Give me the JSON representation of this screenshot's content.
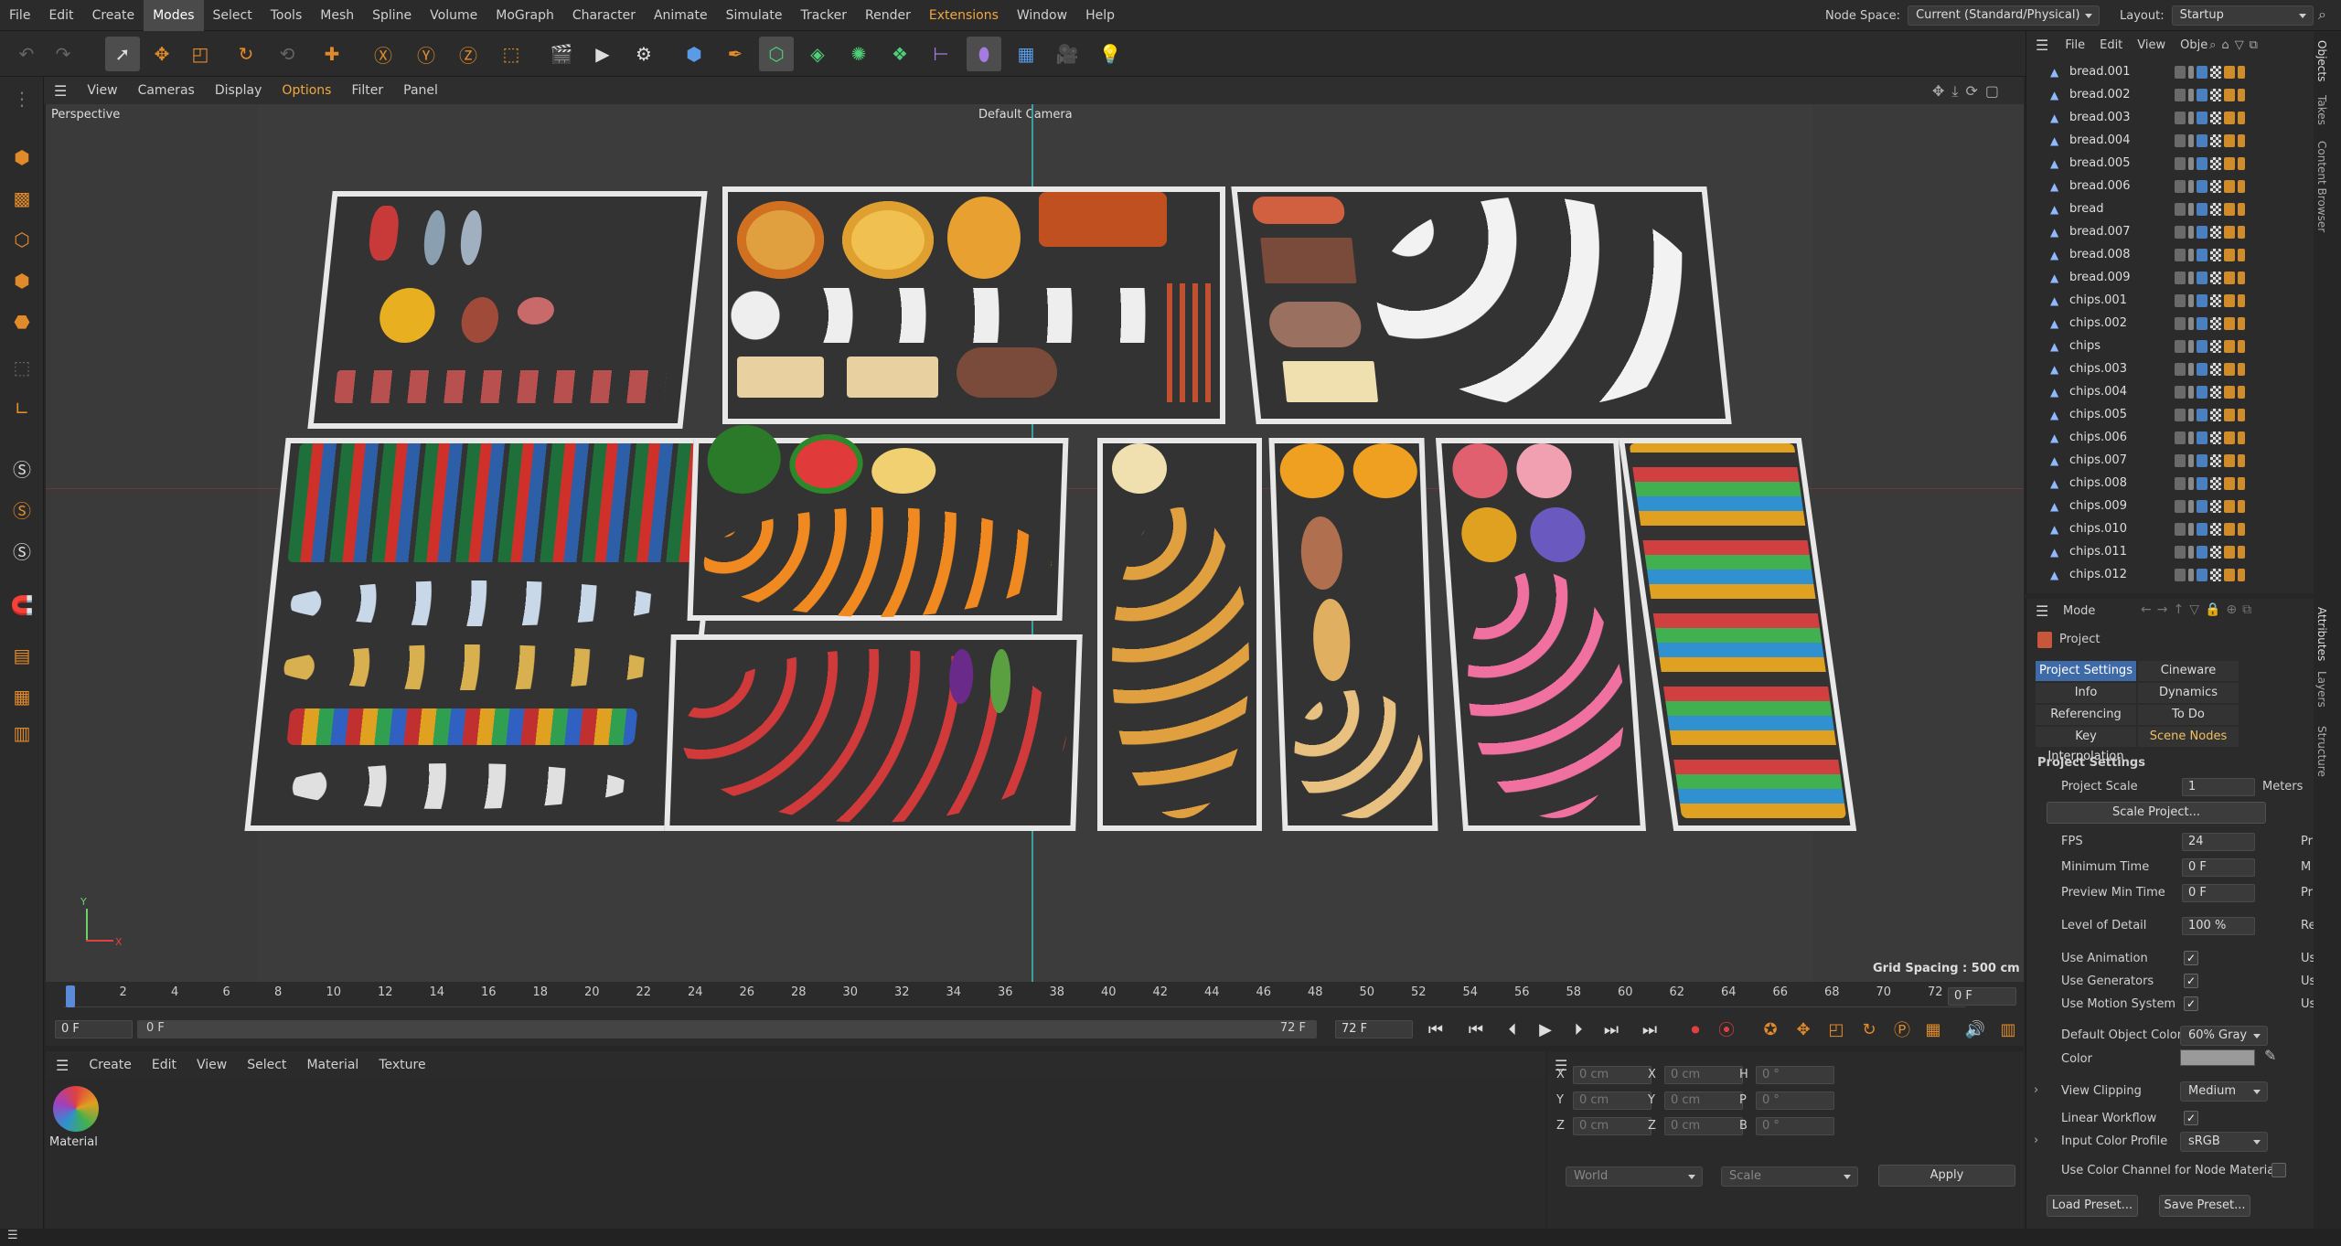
{
  "menubar": {
    "items": [
      "File",
      "Edit",
      "Create",
      "Modes",
      "Select",
      "Tools",
      "Mesh",
      "Spline",
      "Volume",
      "MoGraph",
      "Character",
      "Animate",
      "Simulate",
      "Tracker",
      "Render",
      "Extensions",
      "Window",
      "Help"
    ],
    "node_space_label": "Node Space:",
    "node_space_value": "Current (Standard/Physical)",
    "layout_label": "Layout:",
    "layout_value": "Startup"
  },
  "viewport_menu": [
    "View",
    "Cameras",
    "Display",
    "Options",
    "Filter",
    "Panel"
  ],
  "viewport": {
    "view_name": "Perspective",
    "camera": "Default Camera",
    "grid_spacing": "Grid Spacing : 500 cm",
    "axis_y": "Y",
    "axis_x": "X"
  },
  "timeline": {
    "ticks": [
      "0",
      "2",
      "4",
      "6",
      "8",
      "10",
      "12",
      "14",
      "16",
      "18",
      "20",
      "22",
      "24",
      "26",
      "28",
      "30",
      "32",
      "34",
      "36",
      "38",
      "40",
      "42",
      "44",
      "46",
      "48",
      "50",
      "52",
      "54",
      "56",
      "58",
      "60",
      "62",
      "64",
      "66",
      "68",
      "70",
      "72"
    ],
    "current_frame": "0 F",
    "start_frame": "0 F",
    "range_start": "0 F",
    "range_end": "72 F",
    "end_frame": "72 F"
  },
  "material_menu": [
    "Create",
    "Edit",
    "View",
    "Select",
    "Material",
    "Texture"
  ],
  "material": {
    "name": "Material"
  },
  "coords": {
    "rows": [
      {
        "a": "X",
        "av": "0 cm",
        "b": "X",
        "bv": "0 cm",
        "c": "H",
        "cv": "0 °"
      },
      {
        "a": "Y",
        "av": "0 cm",
        "b": "Y",
        "bv": "0 cm",
        "c": "P",
        "cv": "0 °"
      },
      {
        "a": "Z",
        "av": "0 cm",
        "b": "Z",
        "bv": "0 cm",
        "c": "B",
        "cv": "0 °"
      }
    ],
    "world": "World",
    "scale": "Scale",
    "apply": "Apply"
  },
  "objects": {
    "menu": [
      "File",
      "Edit",
      "View",
      "Obje"
    ],
    "items": [
      "bread.001",
      "bread.002",
      "bread.003",
      "bread.004",
      "bread.005",
      "bread.006",
      "bread",
      "bread.007",
      "bread.008",
      "bread.009",
      "chips.001",
      "chips.002",
      "chips",
      "chips.003",
      "chips.004",
      "chips.005",
      "chips.006",
      "chips.007",
      "chips.008",
      "chips.009",
      "chips.010",
      "chips.011",
      "chips.012"
    ]
  },
  "attributes": {
    "mode": "Mode",
    "project": "Project",
    "tabs": [
      "Project Settings",
      "Cineware",
      "Info",
      "Dynamics",
      "Referencing",
      "To Do",
      "Key Interpolation",
      "Scene Nodes"
    ],
    "section": "Project Settings",
    "project_scale_label": "Project Scale",
    "project_scale_value": "1",
    "project_scale_unit": "Meters",
    "scale_project_btn": "Scale Project...",
    "fps_label": "FPS",
    "fps_value": "24",
    "min_time_label": "Minimum Time",
    "min_time_value": "0 F",
    "preview_min_label": "Preview Min Time",
    "preview_min_value": "0 F",
    "lod_label": "Level of Detail",
    "lod_value": "100 %",
    "use_animation": "Use Animation",
    "use_generators": "Use Generators",
    "use_motion": "Use Motion System",
    "default_obj_color_label": "Default Object Color",
    "default_obj_color_value": "60% Gray",
    "color_label": "Color",
    "view_clipping_label": "View Clipping",
    "view_clipping_value": "Medium",
    "linear_workflow": "Linear Workflow",
    "input_color_profile_label": "Input Color Profile",
    "input_color_profile_value": "sRGB",
    "use_color_channel": "Use Color Channel for Node Material",
    "load_preset": "Load Preset...",
    "save_preset": "Save Preset...",
    "right_cut": [
      "Pr",
      "M",
      "Pr",
      "Re",
      "Us",
      "Us",
      "Us"
    ]
  },
  "side_tabs": [
    "Objects",
    "Takes",
    "Content Browser",
    "Attributes",
    "Layers",
    "Structure"
  ],
  "colors": {
    "accent": "#3f6aa8",
    "orange": "#e08a2a",
    "tray": "#e8e8e8"
  }
}
